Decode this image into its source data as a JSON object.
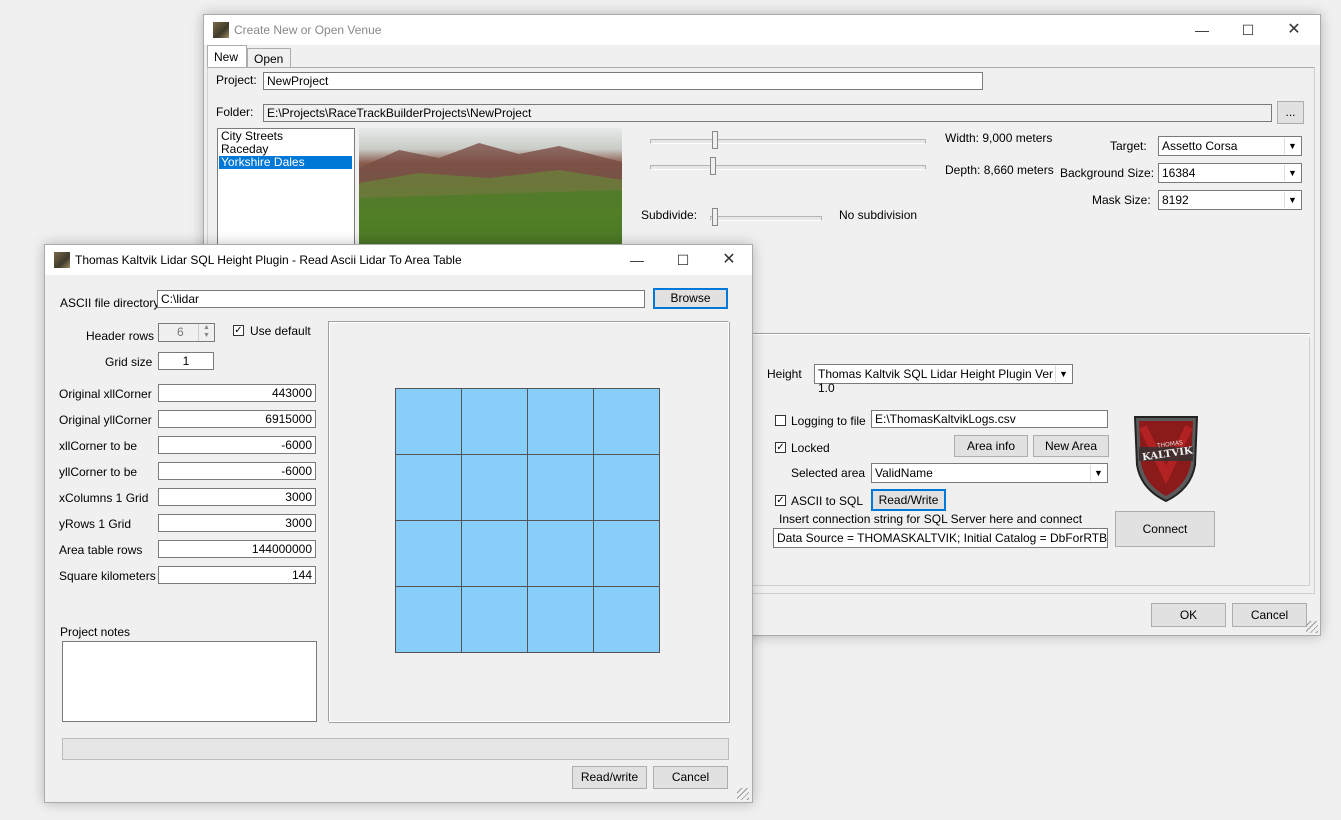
{
  "back_window": {
    "title": "Create New or Open Venue",
    "tabs": [
      "New",
      "Open"
    ],
    "project_label": "Project:",
    "project_value": "NewProject",
    "folder_label": "Folder:",
    "folder_value": "E:\\Projects\\RaceTrackBuilderProjects\\NewProject",
    "browse_dots": "...",
    "templates": [
      "City Streets",
      "Raceday",
      "Yorkshire Dales"
    ],
    "selected_template": "Yorkshire Dales",
    "width_label": "Width: 9,000 meters",
    "depth_label": "Depth: 8,660 meters",
    "subdivide_label": "Subdivide:",
    "subdivide_value": "No subdivision",
    "target_label": "Target:",
    "target_value": "Assetto Corsa",
    "bg_size_label": "Background Size:",
    "bg_size_value": "16384",
    "mask_size_label": "Mask Size:",
    "mask_size_value": "8192",
    "height_label": "Height",
    "height_value": "Thomas Kaltvik SQL Lidar Height Plugin Ver 1.0",
    "logging_label": "Logging to file",
    "logging_value": "E:\\ThomasKaltvikLogs.csv",
    "locked_label": "Locked",
    "area_info_label": "Area info",
    "new_area_label": "New Area",
    "selected_area_label": "Selected area",
    "selected_area_value": "ValidName",
    "ascii_sql_label": "ASCII to SQL",
    "read_write_label": "Read/Write",
    "conn_hint": "Insert connection string for SQL Server here and connect",
    "conn_value": "Data Source = THOMASKALTVIK; Initial Catalog = DbForRTBPlugin;",
    "connect_label": "Connect",
    "logo_text_top": "THOMAS",
    "logo_text_main": "KALTVIK",
    "ok_label": "OK",
    "cancel_label": "Cancel"
  },
  "front_window": {
    "title": "Thomas Kaltvik Lidar SQL Height Plugin - Read Ascii Lidar To Area Table",
    "ascii_dir_label": "ASCII file directory",
    "ascii_dir_value": "C:\\lidar",
    "browse_label": "Browse",
    "header_rows_label": "Header rows",
    "header_rows_value": "6",
    "use_default_label": "Use default",
    "grid_size_label": "Grid size",
    "grid_size_value": "1",
    "fields": [
      {
        "label": "Original xllCorner",
        "value": "443000"
      },
      {
        "label": "Original yllCorner",
        "value": "6915000"
      },
      {
        "label": "xllCorner to be",
        "value": "-6000"
      },
      {
        "label": "yllCorner to be",
        "value": "-6000"
      },
      {
        "label": "xColumns 1 Grid",
        "value": "3000"
      },
      {
        "label": "yRows 1 Grid",
        "value": "3000"
      },
      {
        "label": "Area table rows",
        "value": "144000000"
      },
      {
        "label": "Square kilometers",
        "value": "144"
      }
    ],
    "project_notes_label": "Project notes",
    "read_write_label": "Read/write",
    "cancel_label": "Cancel",
    "grid_color": "#87cefa"
  }
}
